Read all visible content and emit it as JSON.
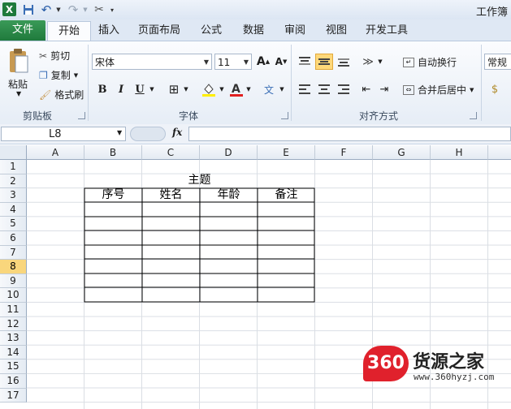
{
  "app": {
    "title": "工作簿",
    "logo_letter": "X"
  },
  "tabs": [
    "文件",
    "开始",
    "插入",
    "页面布局",
    "公式",
    "数据",
    "审阅",
    "视图",
    "开发工具"
  ],
  "active_tab": "开始",
  "ribbon": {
    "clipboard": {
      "paste": "粘贴",
      "cut": "剪切",
      "copy": "复制",
      "format_painter": "格式刷",
      "label": "剪贴板"
    },
    "font": {
      "family": "宋体",
      "size": "11",
      "bold": "B",
      "italic": "I",
      "underline": "U",
      "label": "字体"
    },
    "alignment": {
      "wrap": "自动换行",
      "merge": "合并后居中",
      "label": "对齐方式"
    },
    "number": {
      "format": "常规"
    }
  },
  "formula_bar": {
    "name_box": "L8",
    "fx": "fx",
    "value": ""
  },
  "columns": [
    "A",
    "B",
    "C",
    "D",
    "E",
    "F",
    "G",
    "H"
  ],
  "rows": [
    "1",
    "2",
    "3",
    "4",
    "5",
    "6",
    "7",
    "8",
    "9",
    "10",
    "11",
    "12",
    "13",
    "14",
    "15",
    "16",
    "17"
  ],
  "active_row": "8",
  "sheet": {
    "title_cell": "主题",
    "headers": [
      "序号",
      "姓名",
      "年龄",
      "备注"
    ]
  },
  "watermark": {
    "badge": "360",
    "name": "货源之家",
    "url": "www.360hyzj.com"
  },
  "colors": {
    "file_tab": "#1f7a3c",
    "active_row_header": "#f9d67c",
    "selected_button": "#ffd87a",
    "watermark_red": "#e0212c"
  }
}
